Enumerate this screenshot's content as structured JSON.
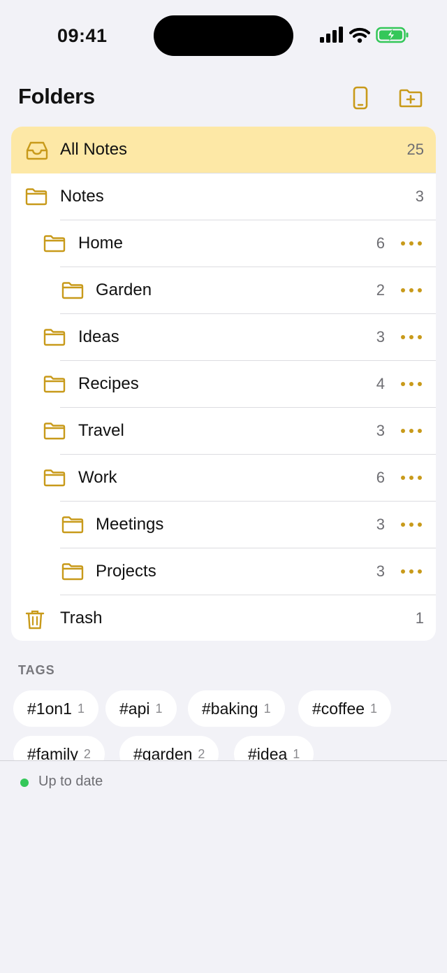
{
  "status_bar": {
    "time": "09:41"
  },
  "header": {
    "title": "Folders"
  },
  "colors": {
    "accent": "#c89a1a",
    "selected_bg": "#fde8a6",
    "sync_ok": "#34c759"
  },
  "folders": [
    {
      "label": "All Notes",
      "count": "25",
      "icon": "tray-icon",
      "level": 0,
      "more": false,
      "selected": true
    },
    {
      "label": "Notes",
      "count": "3",
      "icon": "folder-icon",
      "level": 0,
      "more": false
    },
    {
      "label": "Home",
      "count": "6",
      "icon": "folder-icon",
      "level": 1,
      "more": true
    },
    {
      "label": "Garden",
      "count": "2",
      "icon": "folder-icon",
      "level": 2,
      "more": true
    },
    {
      "label": "Ideas",
      "count": "3",
      "icon": "folder-icon",
      "level": 1,
      "more": true
    },
    {
      "label": "Recipes",
      "count": "4",
      "icon": "folder-icon",
      "level": 1,
      "more": true
    },
    {
      "label": "Travel",
      "count": "3",
      "icon": "folder-icon",
      "level": 1,
      "more": true
    },
    {
      "label": "Work",
      "count": "6",
      "icon": "folder-icon",
      "level": 1,
      "more": true
    },
    {
      "label": "Meetings",
      "count": "3",
      "icon": "folder-icon",
      "level": 2,
      "more": true
    },
    {
      "label": "Projects",
      "count": "3",
      "icon": "folder-icon",
      "level": 2,
      "more": true
    },
    {
      "label": "Trash",
      "count": "1",
      "icon": "trash-icon",
      "level": 0,
      "more": false
    }
  ],
  "tags": {
    "heading": "TAGS",
    "items": [
      {
        "name": "#1on1",
        "count": "1"
      },
      {
        "name": "#api",
        "count": "1"
      },
      {
        "name": "#baking",
        "count": "1"
      },
      {
        "name": "#coffee",
        "count": "1"
      },
      {
        "name": "#family",
        "count": "2"
      },
      {
        "name": "#garden",
        "count": "2"
      },
      {
        "name": "#idea",
        "count": "1"
      }
    ]
  },
  "sync": {
    "status": "Up to date"
  }
}
